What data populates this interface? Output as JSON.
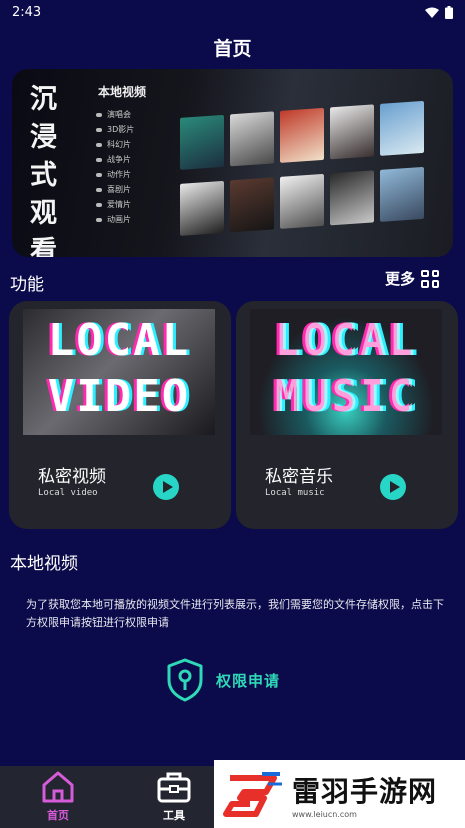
{
  "status": {
    "time": "2:43"
  },
  "header": {
    "title": "首页"
  },
  "banner": {
    "vertical_text": [
      "沉",
      "浸",
      "式",
      "观",
      "看"
    ],
    "menu_title": "本地视频",
    "menu_items": [
      "演唱会",
      "3D影片",
      "科幻片",
      "战争片",
      "动作片",
      "喜剧片",
      "爱情片",
      "动画片"
    ]
  },
  "features": {
    "label": "功能",
    "more_label": "更多",
    "cards": [
      {
        "image_text": "LOCAL VIDEO",
        "title": "私密视频",
        "subtitle": "Local video"
      },
      {
        "image_text": "LOCAL MUSIC",
        "title": "私密音乐",
        "subtitle": "Local music"
      }
    ]
  },
  "local_video": {
    "label": "本地视频",
    "notice": "为了获取您本地可播放的视频文件进行列表展示，我们需要您的文件存储权限，点击下方权限申请按钮进行权限申请",
    "permission_button": "权限申请"
  },
  "tabs": [
    {
      "label": "首页",
      "icon": "home-icon",
      "active": true
    },
    {
      "label": "工具",
      "icon": "toolbox-icon",
      "active": false
    }
  ],
  "watermark": {
    "name": "雷羽手游网",
    "url": "www.leiucn.com"
  },
  "colors": {
    "background": "#0b0a4a",
    "card": "#23242c",
    "accent": "#28d6c8",
    "active_tab": "#d65bd9"
  }
}
